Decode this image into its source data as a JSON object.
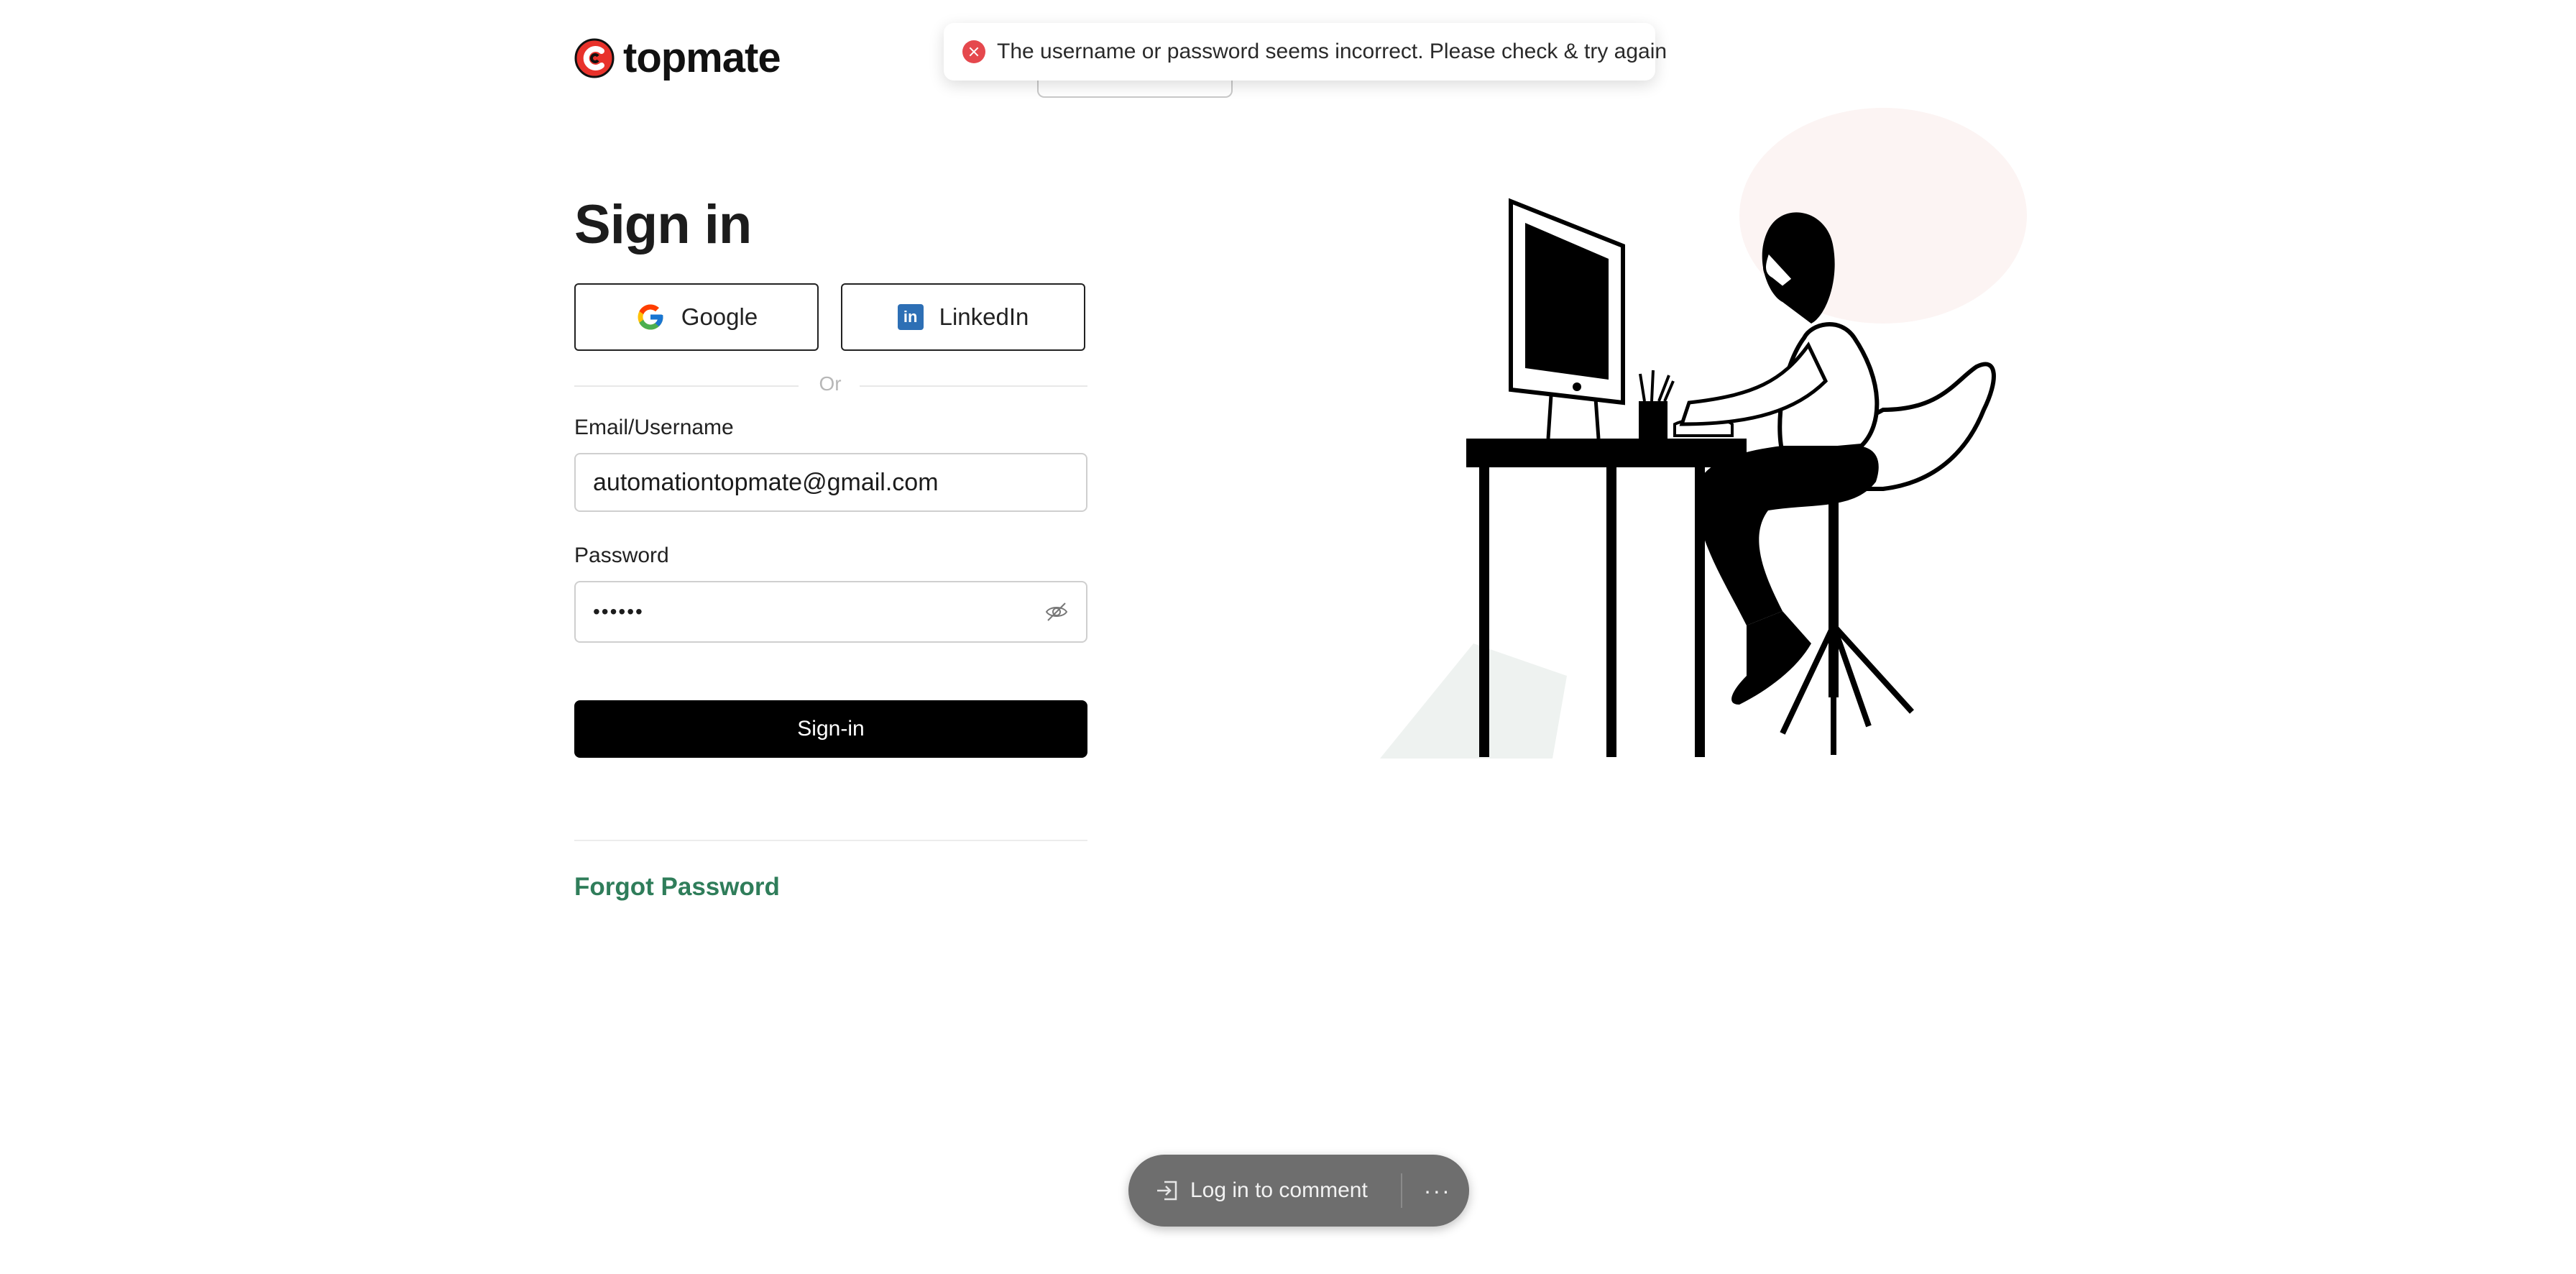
{
  "brand": {
    "name": "topmate",
    "accent": "#e8322b"
  },
  "toast": {
    "message": "The username or password seems incorrect. Please check & try again",
    "icon": "error-x-icon",
    "color": "#e5484d"
  },
  "form": {
    "title": "Sign in",
    "google_label": "Google",
    "linkedin_label": "LinkedIn",
    "or_label": "Or",
    "email_label": "Email/Username",
    "email_value": "automationtopmate@gmail.com",
    "password_label": "Password",
    "password_value": "••••••",
    "submit_label": "Sign-in",
    "forgot_label": "Forgot Password",
    "forgot_color": "#2f7d5a"
  },
  "comment_bar": {
    "label": "Log in to comment",
    "more": "···",
    "icons": [
      "login-icon",
      "more-icon"
    ]
  }
}
